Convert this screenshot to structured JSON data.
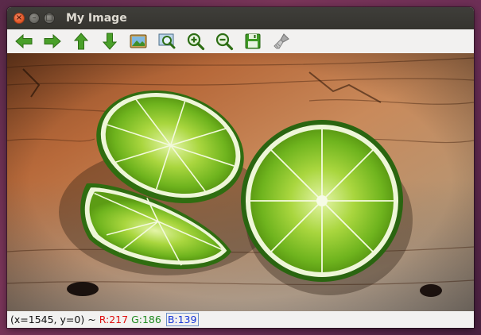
{
  "window": {
    "title": "My Image",
    "controls": {
      "close_icon": "close-icon",
      "minimize_icon": "minimize-icon",
      "maximize_icon": "maximize-icon"
    }
  },
  "toolbar": {
    "buttons": [
      {
        "name": "pan-left-button",
        "icon": "arrow-left-icon"
      },
      {
        "name": "pan-right-button",
        "icon": "arrow-right-icon"
      },
      {
        "name": "pan-up-button",
        "icon": "arrow-up-icon"
      },
      {
        "name": "pan-down-button",
        "icon": "arrow-down-icon"
      },
      {
        "name": "zoom-fit-button",
        "icon": "image-icon"
      },
      {
        "name": "zoom-select-button",
        "icon": "zoom-select-icon"
      },
      {
        "name": "zoom-in-button",
        "icon": "zoom-in-icon"
      },
      {
        "name": "zoom-out-button",
        "icon": "zoom-out-icon"
      },
      {
        "name": "save-button",
        "icon": "save-icon"
      },
      {
        "name": "properties-button",
        "icon": "brush-icon"
      }
    ]
  },
  "status": {
    "coords": "(x=1545, y=0)",
    "separator": "~",
    "r": "R:217",
    "g": "G:186",
    "b": "B:139"
  },
  "colors": {
    "icon_green": "#3a8f1e",
    "title_text": "#dfdbd2",
    "status_r": "#e01010",
    "status_g": "#1f8a1f",
    "status_b": "#1535d8"
  }
}
